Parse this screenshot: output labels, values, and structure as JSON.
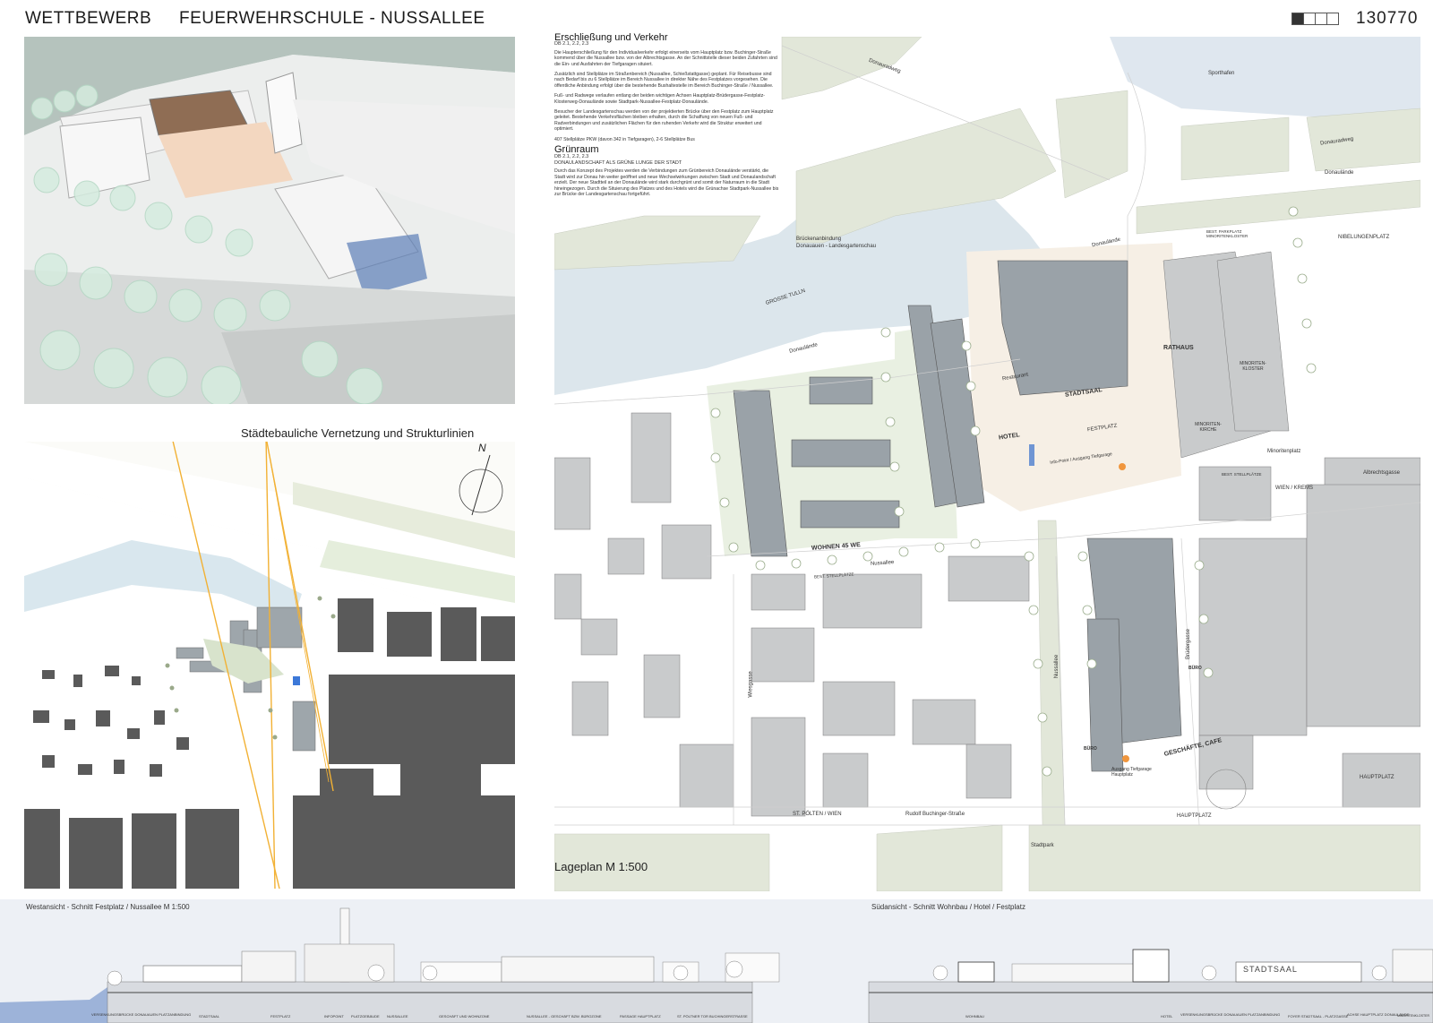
{
  "header": {
    "competition": "WETTBEWERB",
    "project": "FEUERWEHRSCHULE - NUSSALLEE",
    "entry_number": "130770"
  },
  "network": {
    "title": "Städtebauliche Vernetzung und Strukturlinien",
    "north": "N"
  },
  "text": {
    "access_title": "Erschließung und Verkehr",
    "access_ref": "DB 2.1, 2.2, 2.3",
    "access_p1": "Die Haupterschließung für den Individualverkehr erfolgt einerseits vom Hauptplatz bzw. Buchinger-Straße kommend über die Nussallee bzw. von der Albrechtsgasse. An der Schnittstelle dieser beiden Zufahrten sind die Ein- und Ausfahrten der Tiefgaragen situiert.",
    "access_p2": "Zusätzlich sind Stellplätze im Straßenbereich (Nussallee, Schießstattgasse) geplant. Für Reisebusse sind nach Bedarf bis zu 6 Stellplätze im Bereich Nussallee in direkter Nähe des Festplatzes vorgesehen. Die öffentliche Anbindung erfolgt über die bestehende Bushaltestelle im Bereich Buchinger-Straße / Nussallee.",
    "access_p3": "Fuß- und Radwege verlaufen entlang der beiden wichtigen Achsen Hauptplatz-Brüdergasse-Festplatz-Klosterweg-Donaulände sowie Stadtpark-Nussallee-Festplatz-Donaulände.",
    "access_p4": "Besucher der Landesgartenschau werden von der projektierten Brücke über den Festplatz zum Hauptplatz geleitet. Bestehende Verkehrsflächen bleiben erhalten, durch die Schaffung von neuen Fuß- und Radverbindungen und zusätzlichen Flächen für den ruhenden Verkehr wird die Struktur erweitert und optimiert.",
    "access_p5": "407 Stellplätze PKW (davon 342 in Tiefgaragen), 2-6 Stellplätze Bus",
    "green_title": "Grünraum",
    "green_ref": "DB 2.1, 2.2, 2.3",
    "green_sub": "DONAULANDSCHAFT ALS GRÜNE LUNGE DER STADT",
    "green_p1": "Durch das Konzept des Projektes werden die Verbindungen zum Grünbereich Donaulände verstärkt, die Stadt wird zur Donau hin weiter geöffnet und neue Wechselwirkungen zwischen Stadt und Donaulandschaft erzielt. Der neue Stadtteil an der Donaulände wird stark durchgrünt und somit der Naturraum in die Stadt hineingezogen. Durch die Situierung des Platzes und des Hotels wird die Grünachse Stadtpark-Nussallee bis zur Brücke der Landesgartenschau fortgeführt."
  },
  "siteplan": {
    "title": "Lageplan M 1:500",
    "labels": {
      "donauradweg": "Donauradweg",
      "sporthafen": "Sporthafen",
      "donauradweg2": "Donauradweg",
      "donaulaende_r": "Donaulände",
      "nibelungenplatz": "NIBELUNGENPLATZ",
      "best_parkplatz": "BEST. PARKPLATZ MINORITENKLOSTER",
      "brueckenanbindung": "Brückenanbindung",
      "landesgartenschau": "Donauauen - Landesgartenschau",
      "grosse_tulln": "GROSSE TULLN",
      "donaulaende_t": "Donaulände",
      "donaulaende_l": "Donaulände",
      "rathaus": "RATHAUS",
      "stadtsaal": "STADTSAAL",
      "festplatz": "FESTPLATZ",
      "hotel": "HOTEL",
      "restaurant": "Restaurant",
      "minoritenkloster": "MINORITEN-KLOSTER",
      "minoritenkirche": "MINORITEN-KIRCHE",
      "minoritenplatz": "Minoritenplatz",
      "best_stellplaetze": "BEST. STELLPLÄTZE",
      "albrechtsgasse": "Albrechtsgasse",
      "wien_krems": "WIEN / KREMS",
      "info_point": "Info-Point / Ausgang Tiefgarage",
      "wohnen": "WOHNEN 45 WE",
      "nussallee": "Nussallee",
      "best_stellplaetze2": "BEST. STELLPLÄTZE",
      "nussallee_v": "Nussallee",
      "wiesgasse": "Wiesgasse",
      "bruedergasse": "Brüdergasse",
      "buero1": "BÜRO",
      "buero2": "BÜRO",
      "ausgang": "Ausgang Tiefgarage Hauptplatz",
      "geschaefte": "GESCHÄFTE, CAFE",
      "hauptplatz": "HAUPTPLATZ",
      "st_poelten": "ST. PÖLTEN / WIEN",
      "buchinger": "Rudolf Buchinger-Straße",
      "hauptplatz_arrow": "HAUPTPLATZ",
      "stadtpark": "Stadtpark"
    }
  },
  "elevations": {
    "west_title": "Westansicht - Schnitt  Festplatz / Nussallee M 1:500",
    "south_title": "Südansicht - Schnitt  Wohnbau / Hotel / Festplatz",
    "stadtsaal_sign": "STADTSAAL",
    "west_labels": [
      "VERSENKUNGSBRÜCKE DONAUAUEN PLATZANBINDUNG",
      "STADTSAAL",
      "FESTPLATZ",
      "INFOPOINT",
      "PLATZGEBÄUDE",
      "NUSSALLEE",
      "GESCHÄFT UND WOHNZONE",
      "NUSSALLEE - GESCHÄFT BZW. BÜROZONE",
      "PASSAGE HAUPTPLATZ",
      "ST. PÖLTNER TOR BUCHINGERSTRASSE"
    ],
    "south_labels": [
      "WOHNBAU",
      "HOTEL",
      "VERSENKUNGSBRÜCKE DONAUAUEN PLATZANBINDUNG",
      "FOYER STADTSAAL - PLATZGASSE",
      "ACHSE HAUPTPLATZ DONAULÄNDE",
      "MINORITENKLOSTER"
    ]
  }
}
